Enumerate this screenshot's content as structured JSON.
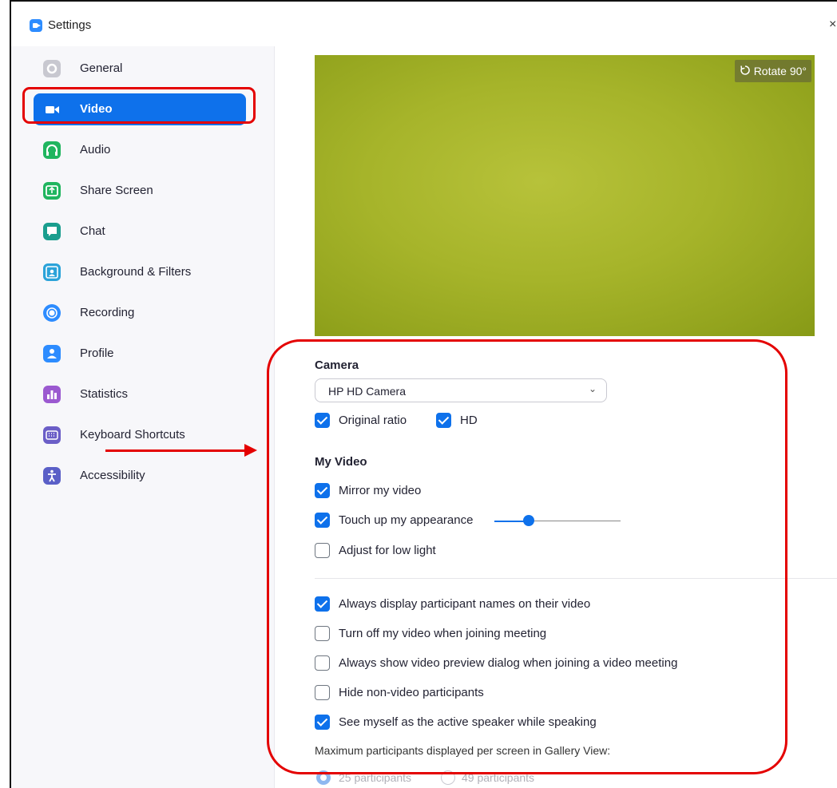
{
  "window": {
    "title": "Settings",
    "close_glyph": "×"
  },
  "sidebar": {
    "items": [
      {
        "label": "General",
        "icon": "gear-icon",
        "color": "#c8c8d0"
      },
      {
        "label": "Video",
        "icon": "video-camera-icon",
        "color": "#ffffff"
      },
      {
        "label": "Audio",
        "icon": "headphones-icon",
        "color": "#20b55f"
      },
      {
        "label": "Share Screen",
        "icon": "share-screen-icon",
        "color": "#20b55f"
      },
      {
        "label": "Chat",
        "icon": "chat-bubble-icon",
        "color": "#1a9e8e"
      },
      {
        "label": "Background & Filters",
        "icon": "background-person-icon",
        "color": "#2ba3d9"
      },
      {
        "label": "Recording",
        "icon": "record-icon",
        "color": "#2d8cff"
      },
      {
        "label": "Profile",
        "icon": "profile-icon",
        "color": "#2d8cff"
      },
      {
        "label": "Statistics",
        "icon": "statistics-icon",
        "color": "#9b59d0"
      },
      {
        "label": "Keyboard Shortcuts",
        "icon": "keyboard-icon",
        "color": "#6b5ec7"
      },
      {
        "label": "Accessibility",
        "icon": "accessibility-icon",
        "color": "#5a5fc7"
      }
    ],
    "active_index": 1
  },
  "preview": {
    "rotate_label": "Rotate 90°",
    "rotate_icon": "rotate-icon"
  },
  "camera": {
    "title": "Camera",
    "selected": "HP HD Camera",
    "original_ratio": {
      "label": "Original ratio",
      "checked": true
    },
    "hd": {
      "label": "HD",
      "checked": true
    }
  },
  "my_video": {
    "title": "My Video",
    "mirror": {
      "label": "Mirror my video",
      "checked": true
    },
    "touch_up": {
      "label": "Touch up my appearance",
      "checked": true,
      "level": 0.28
    },
    "low_light": {
      "label": "Adjust for low light",
      "checked": false
    }
  },
  "options": [
    {
      "label": "Always display participant names on their video",
      "checked": true
    },
    {
      "label": "Turn off my video when joining meeting",
      "checked": false
    },
    {
      "label": "Always show video preview dialog when joining a video meeting",
      "checked": false
    },
    {
      "label": "Hide non-video participants",
      "checked": false
    },
    {
      "label": "See myself as the active speaker while speaking",
      "checked": true
    }
  ],
  "gallery": {
    "label": "Maximum participants displayed per screen in Gallery View:",
    "options": [
      {
        "label": "25 participants",
        "selected": true
      },
      {
        "label": "49 participants",
        "selected": false
      }
    ]
  },
  "colors": {
    "accent": "#0e71eb",
    "annotation": "#e40000"
  }
}
